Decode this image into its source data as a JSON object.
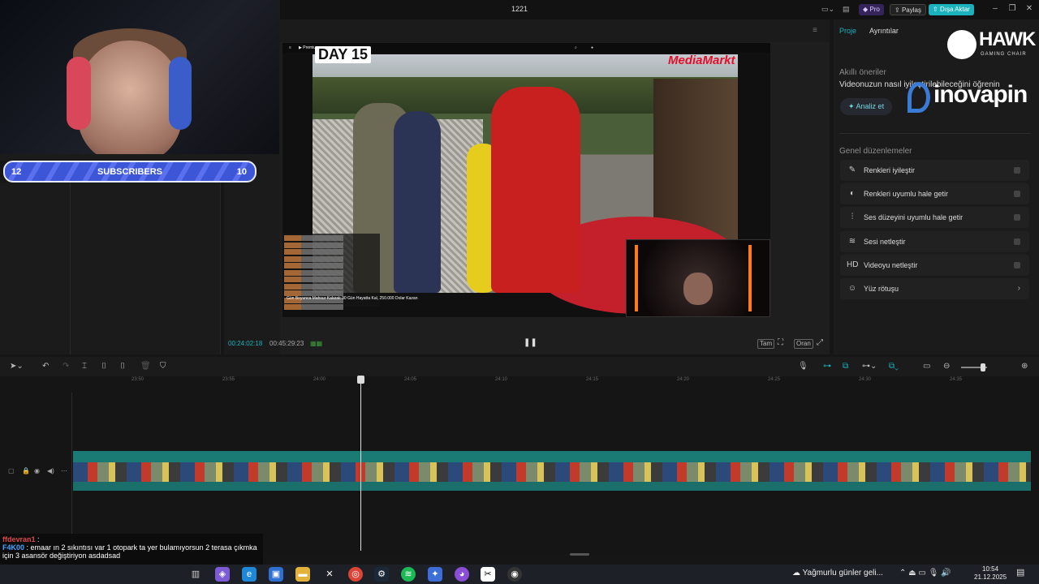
{
  "window": {
    "title": "1221",
    "pro_label": "Pro",
    "share_label": "Paylaş",
    "export_label": "Dışa Aktar"
  },
  "stream_overlay": {
    "subs_left": "12",
    "subs_label": "SUBSCRIBERS",
    "subs_right": "10"
  },
  "video": {
    "day_label": "DAY 15",
    "brand": "MediaMarkt",
    "yt_brand": "Premium",
    "caption": "Gün Boyunca Mahsur Kalarak 30 Gün Hayatta Kal, 250.000 Dolar Kazan"
  },
  "player": {
    "current_time": "00:24:02:18",
    "total_time": "00:45:29:23",
    "full_label": "Tam",
    "ratio_label": "Oran"
  },
  "right_panel": {
    "tabs": [
      "Proje",
      "Ayrıntılar"
    ],
    "suggestions_title": "Akıllı öneriler",
    "suggestions_text": "Videonuzun nasıl iyileştirilebileceğini öğrenin",
    "analyze_label": "Analiz et",
    "edits_title": "Genel düzenlemeler",
    "edits": [
      {
        "label": "Renkleri iyileştir",
        "icon": "✎"
      },
      {
        "label": "Renkleri uyumlu hale getir",
        "icon": "◐"
      },
      {
        "label": "Ses düzeyini uyumlu hale getir",
        "icon": "⫶"
      },
      {
        "label": "Sesi netleştir",
        "icon": "≋"
      },
      {
        "label": "Videoyu netleştir",
        "icon": "HD"
      },
      {
        "label": "Yüz rötuşu",
        "icon": "☺"
      }
    ]
  },
  "sponsors": {
    "hawk": "HAWK",
    "hawk_sub": "GAMING CHAIR",
    "inova": "inovapin"
  },
  "timeline": {
    "ticks": [
      "23:50",
      "23:55",
      "24:00",
      "24:05",
      "24:10",
      "24:15",
      "24:20",
      "24:25",
      "24:30",
      "24:35"
    ]
  },
  "chat": [
    {
      "user": "ffdevran1",
      "msg": ":"
    },
    {
      "user": "F4K00",
      "msg": ": emaar ın 2 sıkıntısı var 1 otopark ta yer bulamıyorsun 2 terasa çıkmka için 3 asansör değiştiriyon asdadsad"
    }
  ],
  "taskbar": {
    "weather": "Yağmurlu günler geli...",
    "time": "10:54",
    "date": "21.12.2025"
  }
}
